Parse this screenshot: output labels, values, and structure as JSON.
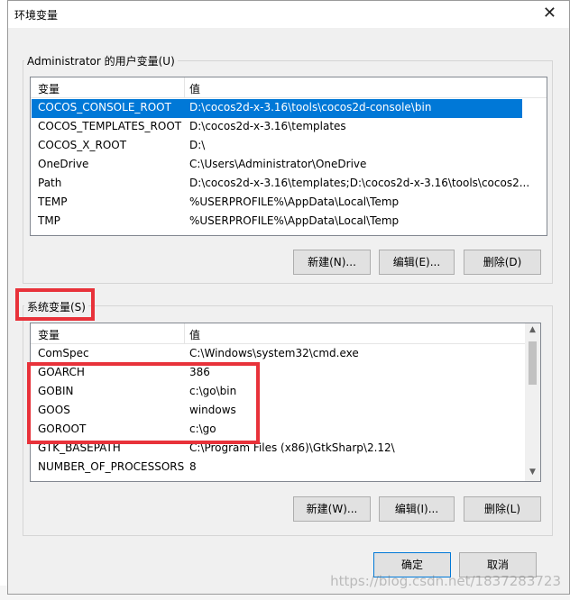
{
  "window": {
    "title": "环境变量",
    "close_glyph": "✕"
  },
  "user_vars": {
    "group_label": "Administrator 的用户变量(U)",
    "col_var": "变量",
    "col_val": "值",
    "rows": [
      {
        "name": "COCOS_CONSOLE_ROOT",
        "value": "D:\\cocos2d-x-3.16\\tools\\cocos2d-console\\bin",
        "selected": true
      },
      {
        "name": "COCOS_TEMPLATES_ROOT",
        "value": "D:\\cocos2d-x-3.16\\templates"
      },
      {
        "name": "COCOS_X_ROOT",
        "value": "D:\\"
      },
      {
        "name": "OneDrive",
        "value": "C:\\Users\\Administrator\\OneDrive"
      },
      {
        "name": "Path",
        "value": "D:\\cocos2d-x-3.16\\templates;D:\\cocos2d-x-3.16\\tools\\cocos2..."
      },
      {
        "name": "TEMP",
        "value": "%USERPROFILE%\\AppData\\Local\\Temp"
      },
      {
        "name": "TMP",
        "value": "%USERPROFILE%\\AppData\\Local\\Temp"
      }
    ],
    "buttons": {
      "new": "新建(N)...",
      "edit": "编辑(E)...",
      "delete": "删除(D)"
    }
  },
  "system_vars": {
    "group_label": "系统变量(S)",
    "col_var": "变量",
    "col_val": "值",
    "rows": [
      {
        "name": "ComSpec",
        "value": "C:\\Windows\\system32\\cmd.exe"
      },
      {
        "name": "GOARCH",
        "value": "386"
      },
      {
        "name": "GOBIN",
        "value": "c:\\go\\bin"
      },
      {
        "name": "GOOS",
        "value": "windows"
      },
      {
        "name": "GOROOT",
        "value": "c:\\go"
      },
      {
        "name": "GTK_BASEPATH",
        "value": "C:\\Program Files (x86)\\GtkSharp\\2.12\\"
      },
      {
        "name": "NUMBER_OF_PROCESSORS",
        "value": "8"
      }
    ],
    "buttons": {
      "new": "新建(W)...",
      "edit": "编辑(I)...",
      "delete": "删除(L)"
    }
  },
  "footer": {
    "ok": "确定",
    "cancel": "取消"
  },
  "watermark": "https://blog.csdn.net/1837283723",
  "colors": {
    "highlight": "#e8323a",
    "selection": "#0078d7"
  }
}
